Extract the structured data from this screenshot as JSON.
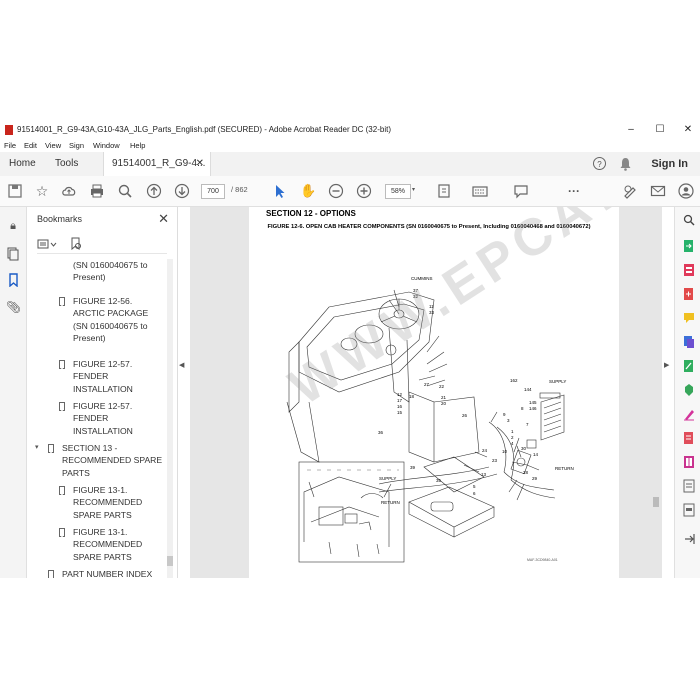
{
  "window": {
    "title": "91514001_R_G9-43A,G10-43A_JLG_Parts_English.pdf (SECURED) - Adobe Acrobat Reader DC (32-bit)",
    "minimize": "–",
    "maximize": "☐",
    "close": "✕"
  },
  "menu": [
    "File",
    "Edit",
    "View",
    "Sign",
    "Window",
    "Help"
  ],
  "tabs": {
    "home": "Home",
    "tools": "Tools",
    "doc": "91514001_R_G9-4...",
    "doc_close": "✕",
    "sign_in": "Sign In",
    "help_icon": "?",
    "bell_icon": "bell-icon"
  },
  "toolbar": {
    "page_current": "700",
    "page_total": "/ 862",
    "zoom": "58%",
    "more": "···"
  },
  "bookmarks": {
    "header": "Bookmarks",
    "close": "✕",
    "items": [
      {
        "label": "(SN 0160040675 to",
        "level": 2,
        "icon": false,
        "caret": false
      },
      {
        "label": "Present)",
        "level": 2,
        "icon": false,
        "caret": false
      },
      {
        "label": "FIGURE 12-56.",
        "level": 2,
        "icon": true,
        "caret": false
      },
      {
        "label": "ARCTIC PACKAGE",
        "level": 2,
        "icon": false,
        "caret": false
      },
      {
        "label": "(SN 0160040675 to",
        "level": 2,
        "icon": false,
        "caret": false
      },
      {
        "label": "Present)",
        "level": 2,
        "icon": false,
        "caret": false
      },
      {
        "label": "FIGURE 12-57.",
        "level": 2,
        "icon": true,
        "caret": false
      },
      {
        "label": "FENDER",
        "level": 2,
        "icon": false,
        "caret": false
      },
      {
        "label": "INSTALLATION",
        "level": 2,
        "icon": false,
        "caret": false
      },
      {
        "label": "FIGURE 12-57.",
        "level": 2,
        "icon": true,
        "caret": false
      },
      {
        "label": "FENDER",
        "level": 2,
        "icon": false,
        "caret": false
      },
      {
        "label": "INSTALLATION",
        "level": 2,
        "icon": false,
        "caret": false
      },
      {
        "label": "SECTION 13 -",
        "level": 1,
        "icon": true,
        "caret": true
      },
      {
        "label": "RECOMMENDED SPARE",
        "level": 1,
        "icon": false,
        "caret": false
      },
      {
        "label": "PARTS",
        "level": 1,
        "icon": false,
        "caret": false
      },
      {
        "label": "FIGURE 13-1.",
        "level": 2,
        "icon": true,
        "caret": false
      },
      {
        "label": "RECOMMENDED",
        "level": 2,
        "icon": false,
        "caret": false
      },
      {
        "label": "SPARE PARTS",
        "level": 2,
        "icon": false,
        "caret": false
      },
      {
        "label": "FIGURE 13-1.",
        "level": 2,
        "icon": true,
        "caret": false
      },
      {
        "label": "RECOMMENDED",
        "level": 2,
        "icon": false,
        "caret": false
      },
      {
        "label": "SPARE PARTS",
        "level": 2,
        "icon": false,
        "caret": false
      },
      {
        "label": "PART NUMBER INDEX",
        "level": 0,
        "icon": true,
        "caret": false
      }
    ]
  },
  "page": {
    "section": "SECTION 12 - OPTIONS",
    "figure_title": "FIGURE 12-6. OPEN CAB HEATER COMPONENTS (SN 0160040675 to Present, Including 0160040468 and 0160040672)",
    "watermark": "WWW.EPCATEPO.COM",
    "labels": {
      "cummins": "CUMMINS",
      "supply_top": "SUPPLY",
      "supply_left": "SUPPLY",
      "return_left": "RETURN",
      "return_right": "RETURN"
    },
    "callouts": [
      "37",
      "32",
      "11",
      "33",
      "27",
      "22",
      "21",
      "20",
      "18",
      "12",
      "17",
      "16",
      "15",
      "26",
      "36",
      "39",
      "35",
      "3",
      "1",
      "2",
      "4",
      "24",
      "23",
      "10",
      "9",
      "8",
      "7",
      "13",
      "5",
      "6",
      "14",
      "28",
      "29",
      "30",
      "162",
      "144",
      "145",
      "146"
    ],
    "footer_code": "MAF-3CD9840-A01"
  }
}
